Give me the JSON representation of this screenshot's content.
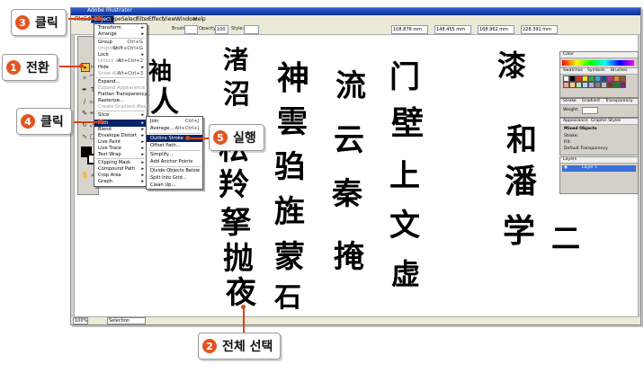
{
  "app": {
    "title": "Adobe Illustrator",
    "menus": [
      "File",
      "Edit",
      "Object",
      "Type",
      "Select",
      "Filter",
      "Effect",
      "View",
      "Window",
      "Help"
    ],
    "active_menu": "Object"
  },
  "options_bar": {
    "brush_label": "Brush:",
    "opacity_label": "Opacity:",
    "opacity_value": "100",
    "style_label": "Style:",
    "x_value": "108.878 mm",
    "y_value": "148.455 mm",
    "w_value": "168.962 mm",
    "h_value": "228.391 mm"
  },
  "object_menu": {
    "items": [
      {
        "label": "Transform",
        "shortcut": "",
        "submenu": true,
        "disabled": false,
        "highlight": false
      },
      {
        "label": "Arrange",
        "shortcut": "",
        "submenu": true,
        "disabled": false,
        "highlight": false
      },
      {
        "label": "Group",
        "shortcut": "Ctrl+G",
        "submenu": false,
        "disabled": false,
        "highlight": false
      },
      {
        "label": "Ungroup",
        "shortcut": "Shift+Ctrl+G",
        "submenu": false,
        "disabled": true,
        "highlight": false
      },
      {
        "label": "Lock",
        "shortcut": "",
        "submenu": true,
        "disabled": false,
        "highlight": false
      },
      {
        "label": "Unlock All",
        "shortcut": "Alt+Ctrl+2",
        "submenu": false,
        "disabled": true,
        "highlight": false
      },
      {
        "label": "Hide",
        "shortcut": "",
        "submenu": true,
        "disabled": false,
        "highlight": false
      },
      {
        "label": "Show All",
        "shortcut": "Alt+Ctrl+3",
        "submenu": false,
        "disabled": true,
        "highlight": false
      },
      {
        "label": "Expand...",
        "shortcut": "",
        "submenu": false,
        "disabled": false,
        "highlight": false
      },
      {
        "label": "Expand Appearance",
        "shortcut": "",
        "submenu": false,
        "disabled": true,
        "highlight": false
      },
      {
        "label": "Flatten Transparency...",
        "shortcut": "",
        "submenu": false,
        "disabled": false,
        "highlight": false
      },
      {
        "label": "Rasterize...",
        "shortcut": "",
        "submenu": false,
        "disabled": false,
        "highlight": false
      },
      {
        "label": "Create Gradient Mesh...",
        "shortcut": "",
        "submenu": false,
        "disabled": true,
        "highlight": false
      },
      {
        "label": "Slice",
        "shortcut": "",
        "submenu": true,
        "disabled": false,
        "highlight": false
      },
      {
        "label": "Path",
        "shortcut": "",
        "submenu": true,
        "disabled": false,
        "highlight": true
      },
      {
        "label": "Blend",
        "shortcut": "",
        "submenu": true,
        "disabled": false,
        "highlight": false
      },
      {
        "label": "Envelope Distort",
        "shortcut": "",
        "submenu": true,
        "disabled": false,
        "highlight": false
      },
      {
        "label": "Live Paint",
        "shortcut": "",
        "submenu": true,
        "disabled": false,
        "highlight": false
      },
      {
        "label": "Live Trace",
        "shortcut": "",
        "submenu": true,
        "disabled": false,
        "highlight": false
      },
      {
        "label": "Text Wrap",
        "shortcut": "",
        "submenu": true,
        "disabled": false,
        "highlight": false
      },
      {
        "label": "Clipping Mask",
        "shortcut": "",
        "submenu": true,
        "disabled": false,
        "highlight": false
      },
      {
        "label": "Compound Path",
        "shortcut": "",
        "submenu": true,
        "disabled": false,
        "highlight": false
      },
      {
        "label": "Crop Area",
        "shortcut": "",
        "submenu": true,
        "disabled": false,
        "highlight": false
      },
      {
        "label": "Graph",
        "shortcut": "",
        "submenu": true,
        "disabled": false,
        "highlight": false
      }
    ]
  },
  "path_submenu": {
    "items": [
      {
        "label": "Join",
        "shortcut": "Ctrl+J",
        "highlight": false
      },
      {
        "label": "Average...",
        "shortcut": "Alt+Ctrl+J",
        "highlight": false
      },
      {
        "label": "Outline Stroke",
        "shortcut": "",
        "highlight": true
      },
      {
        "label": "Offset Path...",
        "shortcut": "",
        "highlight": false
      },
      {
        "label": "Simplify...",
        "shortcut": "",
        "highlight": false
      },
      {
        "label": "Add Anchor Points",
        "shortcut": "",
        "highlight": false
      },
      {
        "label": "Divide Objects Below",
        "shortcut": "",
        "highlight": false
      },
      {
        "label": "Split Into Grid...",
        "shortcut": "",
        "highlight": false
      },
      {
        "label": "Clean Up...",
        "shortcut": "",
        "highlight": false
      }
    ]
  },
  "panels": {
    "color_title": "Color",
    "swatches_title": "Swatches",
    "symbols_title": "Symbols",
    "brushes_title": "Brushes",
    "stroke_title": "Stroke",
    "gradient_title": "Gradient",
    "transparency_title": "Transparency",
    "weight_label": "Weight:",
    "appearance_title": "Appearance",
    "graphic_styles_title": "Graphic Styles",
    "mixed_objects": "Mixed Objects",
    "stroke_label": "Stroke:",
    "fill_label": "Fill:",
    "default_transparency": "Default Transparency",
    "layers_title": "Layers",
    "layer_name": "Layer 1"
  },
  "status": {
    "zoom": "100%",
    "tool": "Selection"
  },
  "calligraphy": [
    "袖",
    "人",
    "渚",
    "沼",
    "松",
    "羚",
    "拏",
    "抛",
    "夜",
    "虚",
    "漆",
    "神",
    "雲",
    "驺",
    "旌",
    "蒙",
    "石",
    "流",
    "云",
    "秦",
    "掩",
    "门",
    "壁",
    "上",
    "文",
    "和",
    "潘",
    "学",
    "二"
  ],
  "callouts": [
    {
      "num": "1",
      "text": "전환"
    },
    {
      "num": "2",
      "text": "전체 선택"
    },
    {
      "num": "3",
      "text": "클릭"
    },
    {
      "num": "4",
      "text": "클릭"
    },
    {
      "num": "5",
      "text": "실행"
    }
  ],
  "colors": {
    "accent": "#e25520",
    "menu_highlight": "#0a246a",
    "title_bar": "#0a2f9c"
  }
}
